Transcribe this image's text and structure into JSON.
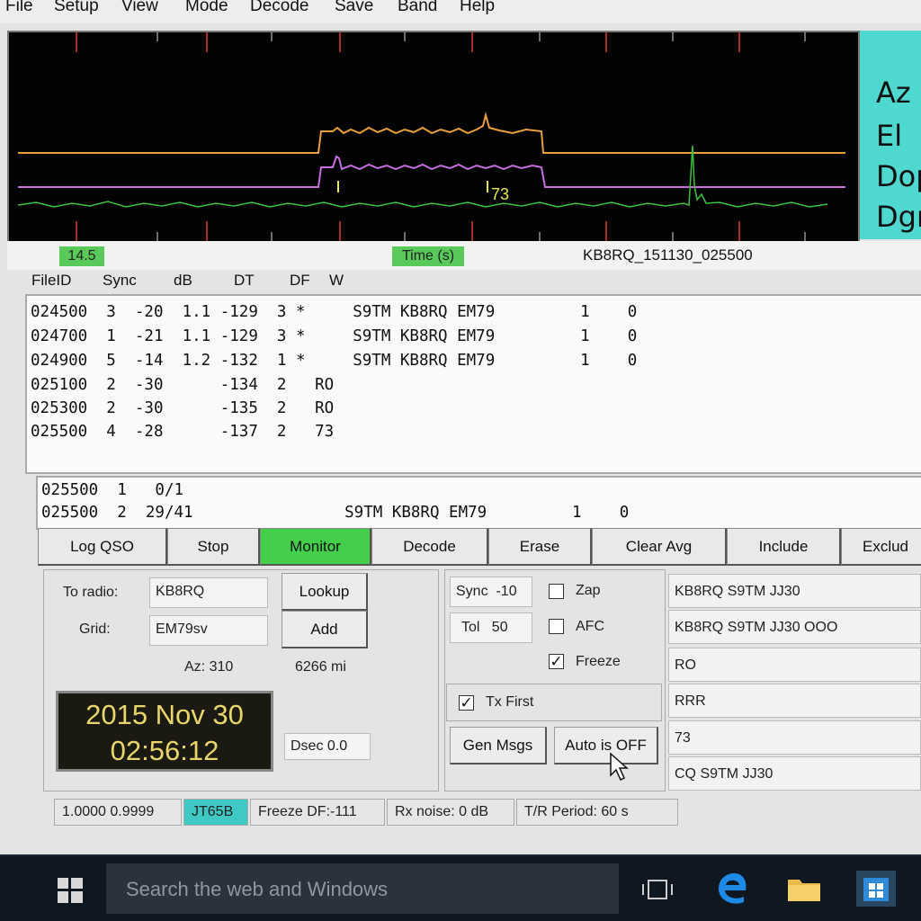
{
  "menu": [
    "File",
    "Setup",
    "View",
    "Mode",
    "Decode",
    "Save",
    "Band",
    "Help"
  ],
  "side_labels": [
    "Az",
    "El",
    "Dop",
    "Dgr"
  ],
  "plot": {
    "marker_73": "73",
    "marker_i1": "I",
    "marker_i2": "I"
  },
  "axis": {
    "left_value": "14.5",
    "time_label": "Time (s)",
    "filename": "KB8RQ_151130_025500"
  },
  "columns": [
    "FileID",
    "Sync",
    "dB",
    "DT",
    "DF",
    "W"
  ],
  "decodes": [
    "024500  3  -20  1.1 -129  3 *     S9TM KB8RQ EM79         1    0",
    "024700  1  -21  1.1 -129  3 *     S9TM KB8RQ EM79         1    0",
    "024900  5  -14  1.2 -132  1 *     S9TM KB8RQ EM79         1    0",
    "025100  2  -30      -134  2   RO",
    "025300  2  -30      -135  2   RO",
    "025500  4  -28      -137  2   73"
  ],
  "averages": [
    "025500  1   0/1",
    "025500  2  29/41                S9TM KB8RQ EM79         1    0"
  ],
  "buttons": [
    "Log QSO",
    "Stop",
    "Monitor",
    "Decode",
    "Erase",
    "Clear Avg",
    "Include",
    "Exclud"
  ],
  "station": {
    "to_radio_label": "To radio:",
    "to_radio": "KB8RQ",
    "lookup": "Lookup",
    "grid_label": "Grid:",
    "grid": "EM79sv",
    "add": "Add",
    "az": "Az: 310",
    "distance": "6266 mi"
  },
  "clock": {
    "date": "2015 Nov 30",
    "time": "02:56:12",
    "dsec": "Dsec  0.0"
  },
  "controls": {
    "sync_label": "Sync",
    "sync": "-10",
    "tol_label": "Tol",
    "tol": "50",
    "zap": "Zap",
    "afc": "AFC",
    "freeze": "Freeze",
    "tx_first": "Tx First",
    "gen_msgs": "Gen Msgs",
    "auto": "Auto is OFF",
    "check_mark": "✓"
  },
  "messages": [
    "KB8RQ S9TM JJ30",
    "KB8RQ S9TM JJ30 OOO",
    "RO",
    "RRR",
    "73",
    "CQ S9TM JJ30"
  ],
  "status": [
    "1.0000 0.9999",
    "JT65B",
    "Freeze DF:-111",
    "Rx noise:  0 dB",
    "T/R Period: 60 s"
  ],
  "taskbar": {
    "search_placeholder": "Search the web and Windows"
  },
  "colors": {
    "monitor_active": "#43cf4a",
    "mode_badge": "#40c9c4",
    "clock_text": "#ead56a"
  }
}
